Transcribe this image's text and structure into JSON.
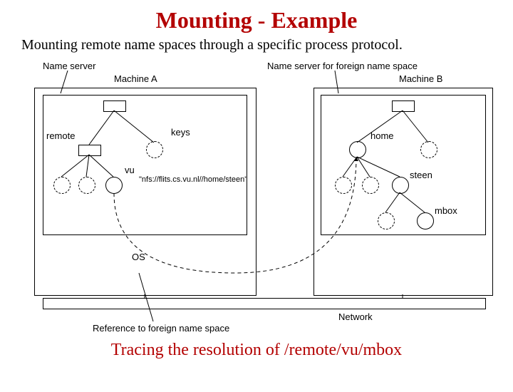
{
  "title": "Mounting - Example",
  "subtitle": "Mounting remote name spaces through a specific process protocol.",
  "labels": {
    "name_server_a": "Name server",
    "name_server_b": "Name server for foreign name space",
    "machine_a": "Machine A",
    "machine_b": "Machine B",
    "remote": "remote",
    "keys": "keys",
    "vu": "vu",
    "nfs_url": "\"nfs://flits.cs.vu.nl//home/steen\"",
    "home": "home",
    "steen": "steen",
    "mbox": "mbox",
    "os_a": "OS",
    "ref_foreign": "Reference to foreign name space",
    "network": "Network"
  },
  "caption": "Tracing the resolution of /remote/vu/mbox"
}
